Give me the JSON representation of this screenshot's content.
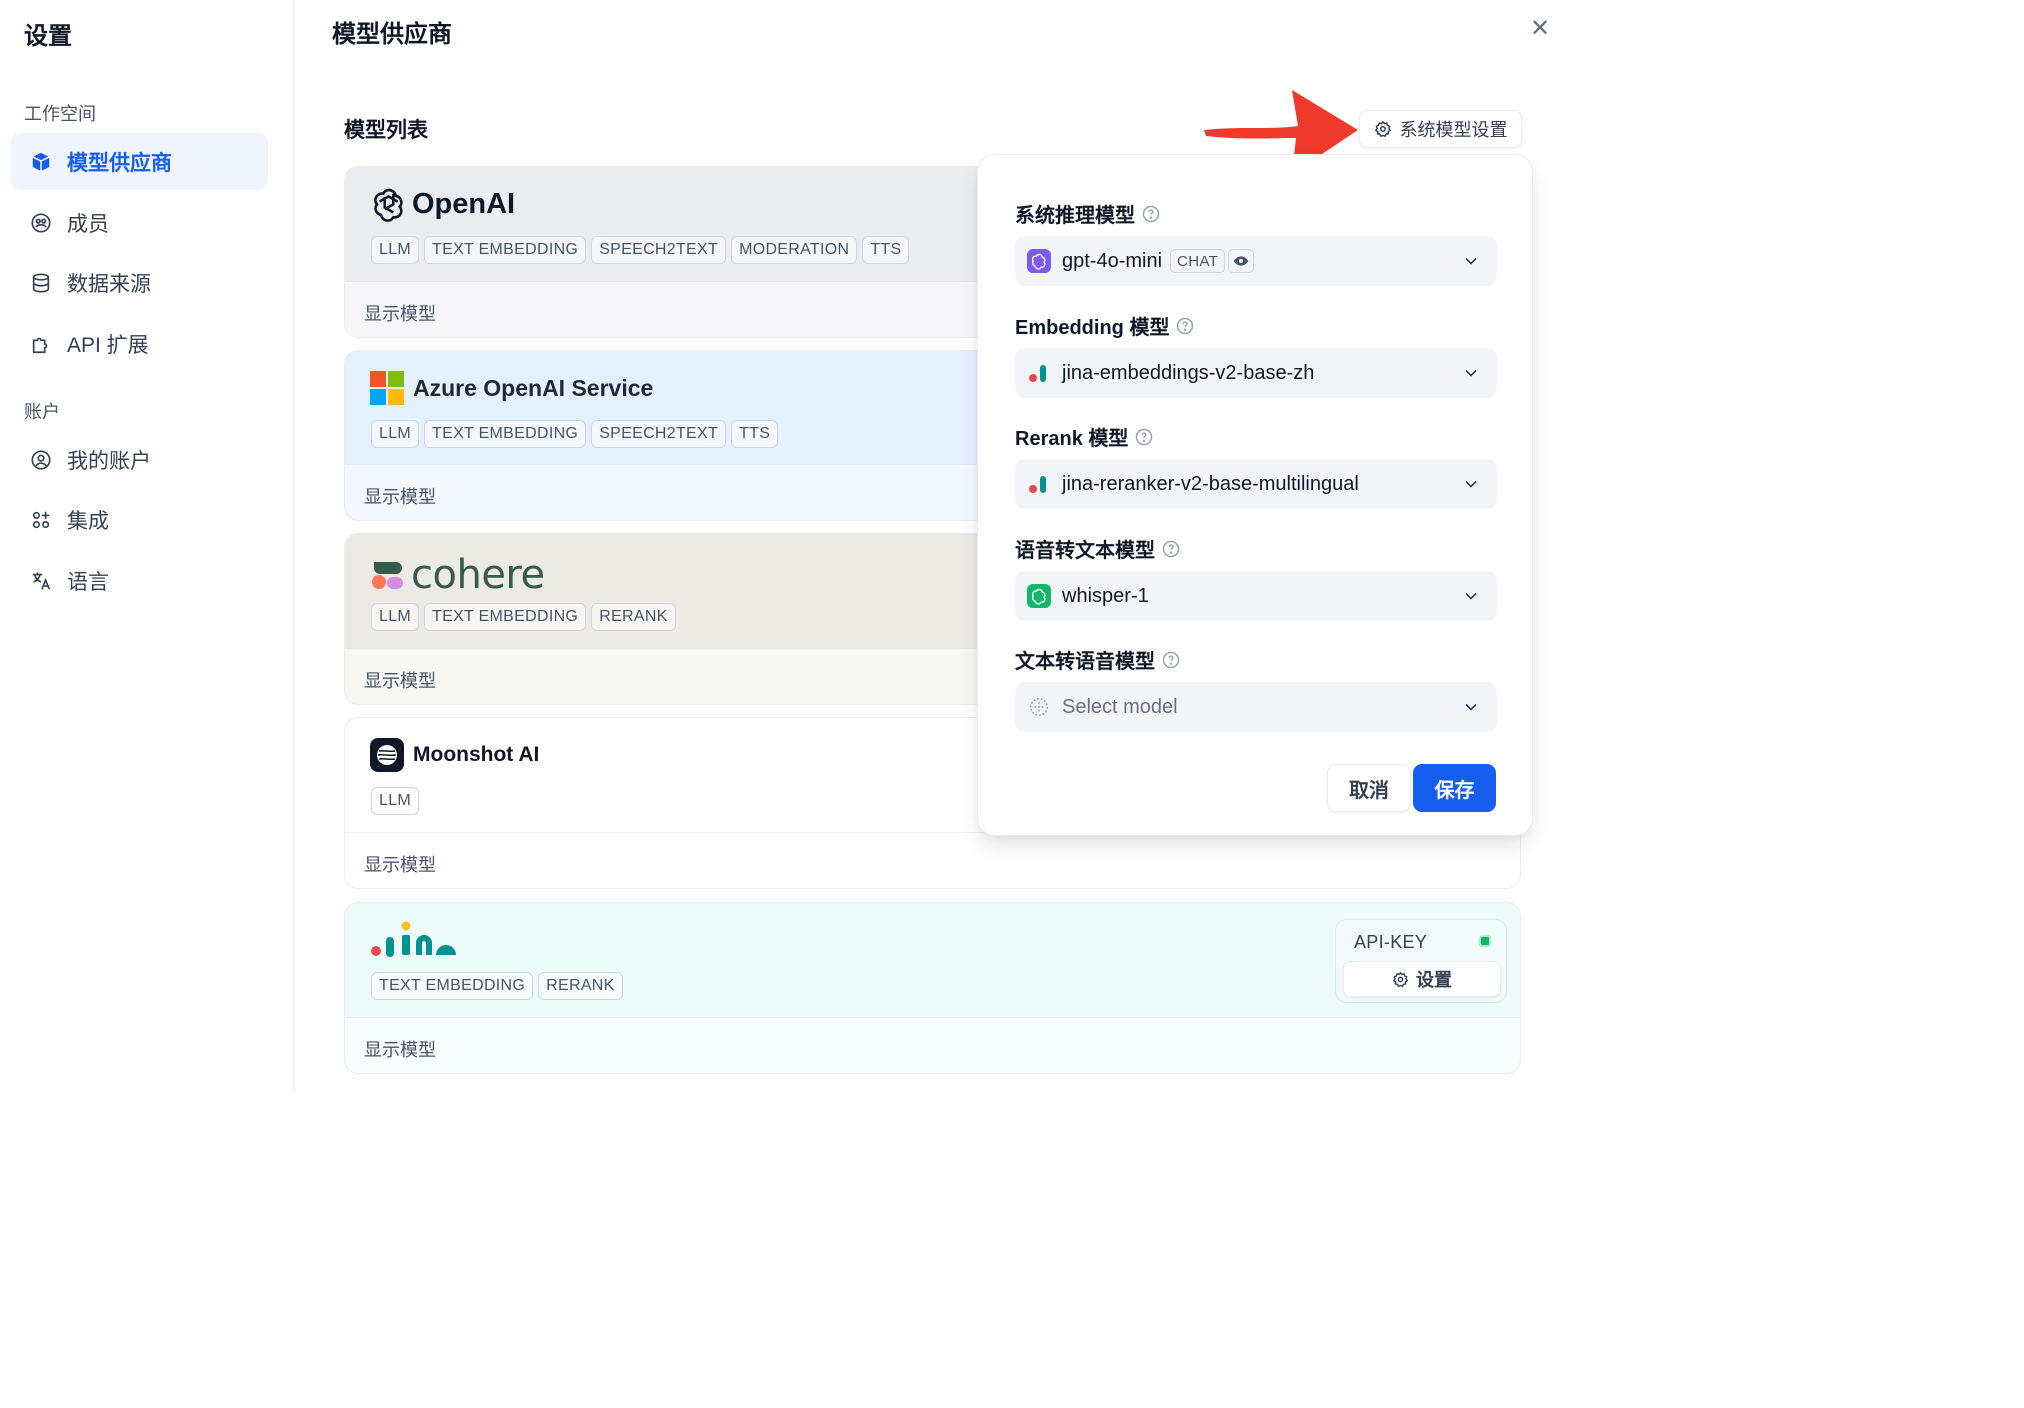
{
  "sidebar": {
    "title": "设置",
    "groups": [
      {
        "label": "工作空间"
      },
      {
        "label": "账户"
      }
    ],
    "items": [
      {
        "label": "模型供应商",
        "icon": "cube-icon",
        "active": true
      },
      {
        "label": "成员",
        "icon": "members-icon"
      },
      {
        "label": "数据来源",
        "icon": "database-icon"
      },
      {
        "label": "API 扩展",
        "icon": "puzzle-icon"
      },
      {
        "label": "我的账户",
        "icon": "account-icon"
      },
      {
        "label": "集成",
        "icon": "integration-icon"
      },
      {
        "label": "语言",
        "icon": "language-icon"
      }
    ]
  },
  "header": {
    "title": "模型供应商",
    "close_icon": "close-icon"
  },
  "main": {
    "list_title": "模型列表",
    "system_model_button": "系统模型设置",
    "providers": [
      {
        "name": "OpenAI",
        "tags": [
          "LLM",
          "TEXT EMBEDDING",
          "SPEECH2TEXT",
          "MODERATION",
          "TTS"
        ],
        "show_models": "显示模型",
        "color": "#eaecf0"
      },
      {
        "name": "Azure OpenAI Service",
        "tags": [
          "LLM",
          "TEXT EMBEDDING",
          "SPEECH2TEXT",
          "TTS"
        ],
        "show_models": "显示模型",
        "color": "#e4f0fd"
      },
      {
        "name": "cohere",
        "tags": [
          "LLM",
          "TEXT EMBEDDING",
          "RERANK"
        ],
        "show_models": "显示模型",
        "color": "#eceae5"
      },
      {
        "name": "Moonshot AI",
        "tags": [
          "LLM"
        ],
        "show_models": "显示模型",
        "color": "#ffffff"
      },
      {
        "name": "jina",
        "tags": [
          "TEXT EMBEDDING",
          "RERANK"
        ],
        "show_models": "显示模型",
        "color": "#edfafa"
      }
    ],
    "api_key": {
      "label": "API-KEY",
      "button": "设置",
      "status_color": "#12b76a"
    }
  },
  "popover": {
    "fields": [
      {
        "label": "系统推理模型",
        "value": "gpt-4o-mini",
        "chip": "CHAT",
        "icon": "openai-purple-icon"
      },
      {
        "label": "Embedding 模型",
        "value": "jina-embeddings-v2-base-zh",
        "icon": "jina-icon"
      },
      {
        "label": "Rerank 模型",
        "value": "jina-reranker-v2-base-multilingual",
        "icon": "jina-icon"
      },
      {
        "label": "语音转文本模型",
        "value": "whisper-1",
        "icon": "openai-green-icon"
      },
      {
        "label": "文本转语音模型",
        "value": "Select model",
        "icon": "placeholder-cube-icon",
        "placeholder": true
      }
    ],
    "cancel_label": "取消",
    "save_label": "保存"
  },
  "colors": {
    "accent": "#155eef",
    "arrow": "#f03a2e"
  }
}
